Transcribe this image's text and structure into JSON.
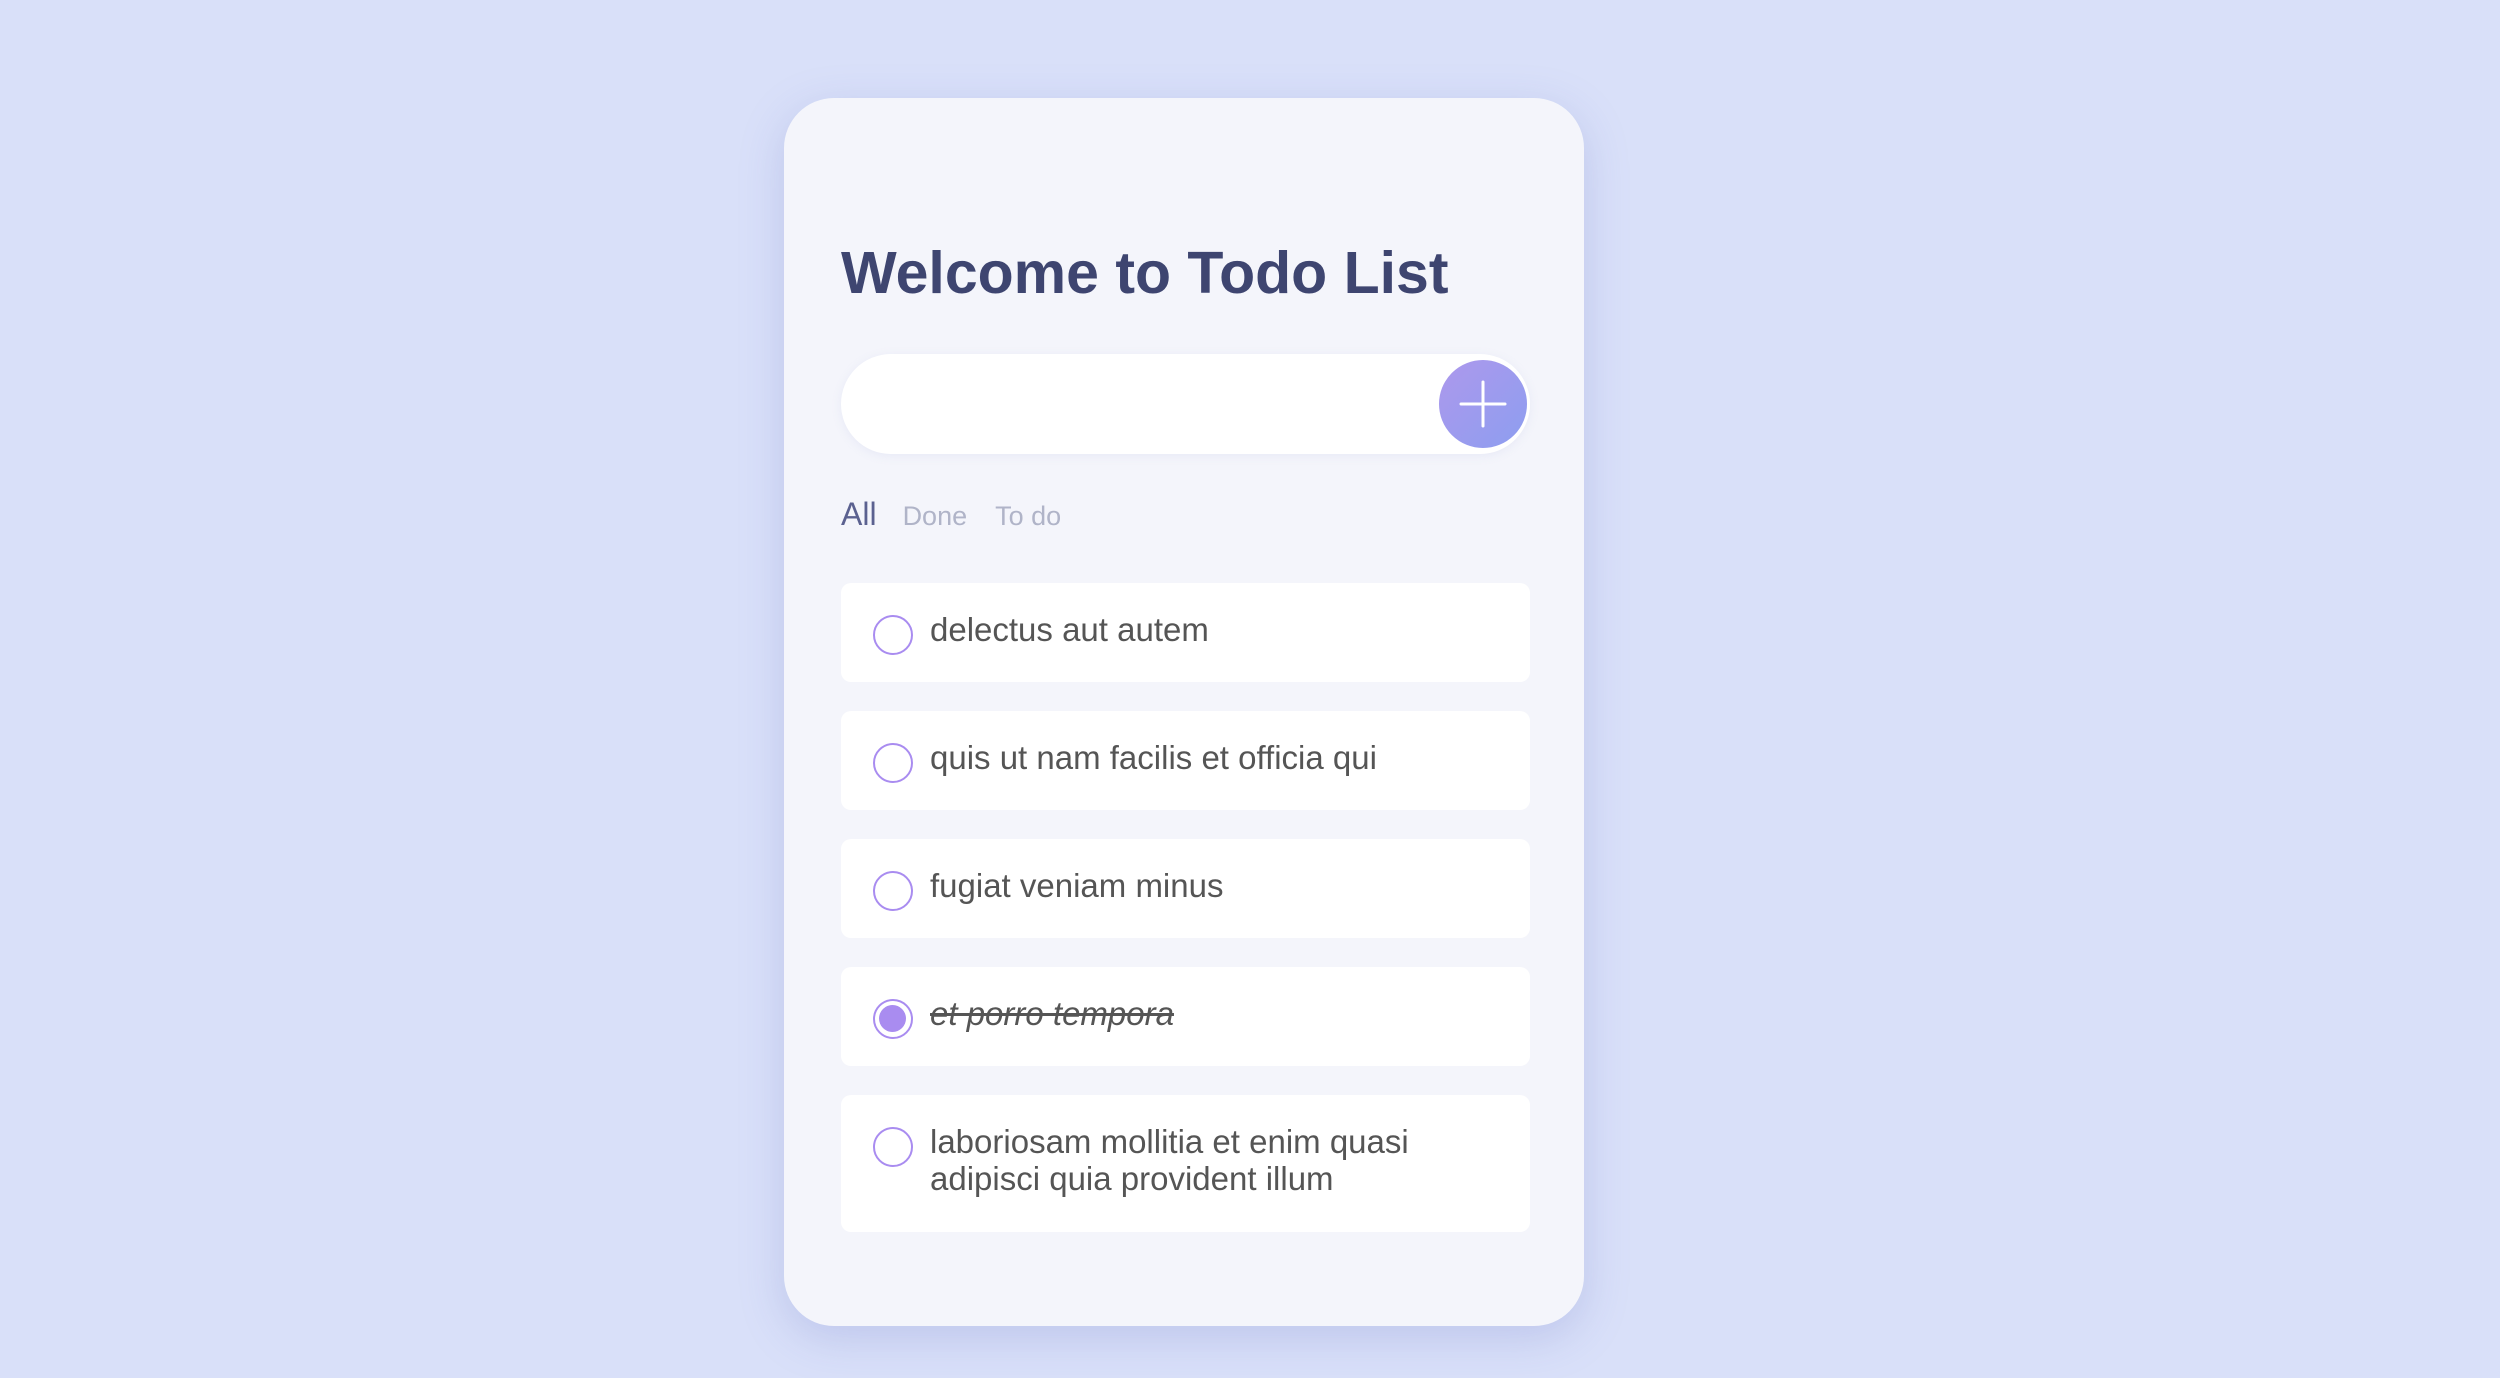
{
  "app": {
    "title": "Welcome to Todo List"
  },
  "input": {
    "value": "",
    "placeholder": "",
    "add_icon": "plus-icon"
  },
  "filters": [
    {
      "label": "All",
      "active": true
    },
    {
      "label": "Done",
      "active": false
    },
    {
      "label": "To do",
      "active": false
    }
  ],
  "todos": [
    {
      "text": "delectus aut autem",
      "done": false
    },
    {
      "text": "quis ut nam facilis et officia qui",
      "done": false
    },
    {
      "text": "fugiat veniam minus",
      "done": false
    },
    {
      "text": "et porro tempora",
      "done": true
    },
    {
      "text": "laboriosam mollitia et enim quasi adipisci quia provident illum",
      "done": false
    }
  ],
  "colors": {
    "background": "#d9e0f9",
    "card": "#f4f5fb",
    "title": "#3e4570",
    "accent": "#a98cf0",
    "button_gradient_start": "#ad98ec",
    "button_gradient_end": "#8d9ef0",
    "filter_active": "#5b6190",
    "filter_inactive": "#b0b4c8",
    "item_text": "#555555"
  }
}
